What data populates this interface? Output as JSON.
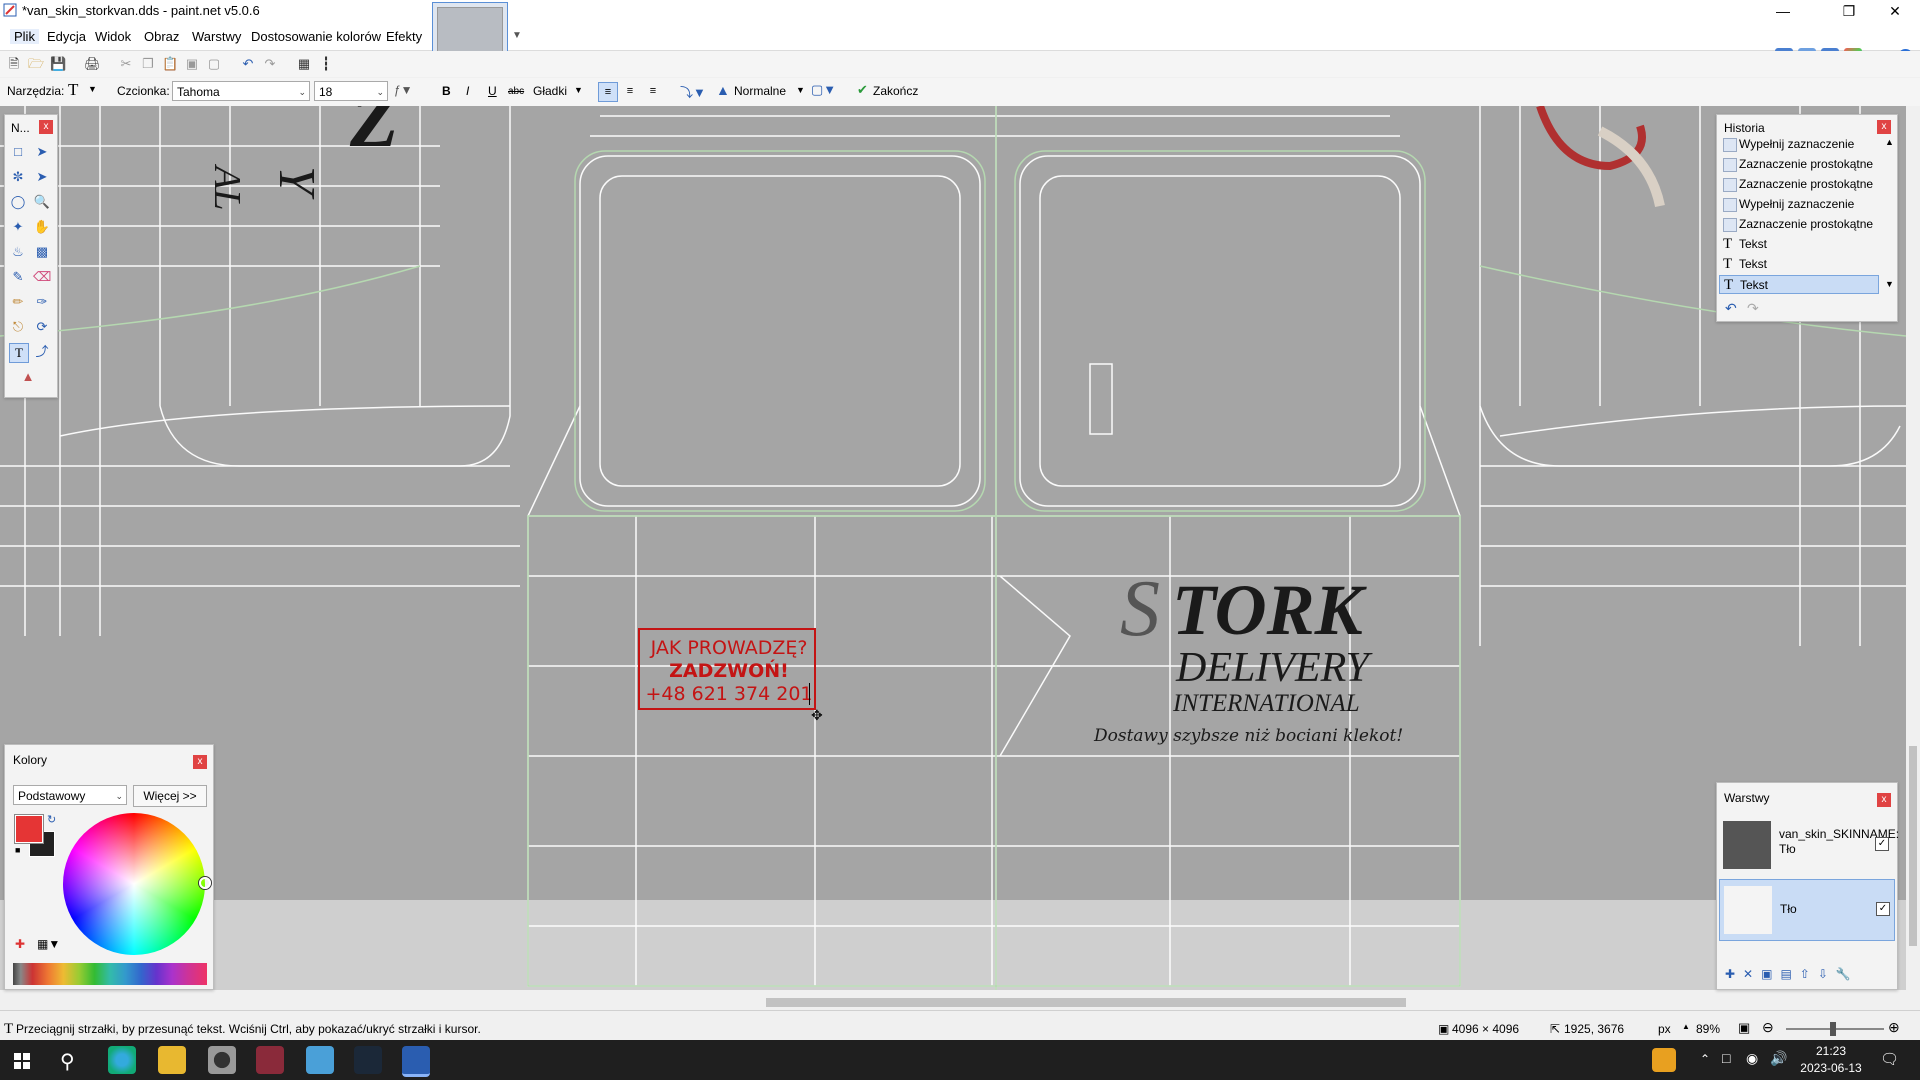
{
  "window": {
    "title": "*van_skin_storkvan.dds - paint.net v5.0.6"
  },
  "menu": [
    "Plik",
    "Edycja",
    "Widok",
    "Obraz",
    "Warstwy",
    "Dostosowanie kolorów",
    "Efekty"
  ],
  "toolbar2": {
    "tool_label": "Narzędzia:",
    "font_label": "Czcionka:",
    "font_value": "Tahoma",
    "size_value": "18",
    "bold": "B",
    "italic": "I",
    "underline": "U",
    "strike": "abc",
    "antialias": "Gładki",
    "blend": "Normalne",
    "finish": "Zakończ"
  },
  "tools_panel": {
    "title": "N..."
  },
  "history": {
    "title": "Historia",
    "items": [
      "Wypełnij zaznaczenie",
      "Zaznaczenie prostokątne",
      "Zaznaczenie prostokątne",
      "Wypełnij zaznaczenie",
      "Zaznaczenie prostokątne",
      "Tekst",
      "Tekst",
      "Tekst"
    ],
    "selected_index": 7
  },
  "colors": {
    "title": "Kolory",
    "mode": "Podstawowy",
    "more": "Więcej >>",
    "primary": "#e53535",
    "secondary": "#222222"
  },
  "layers": {
    "title": "Warstwy",
    "items": [
      {
        "name": "van_skin_SKINNAME: Tło",
        "visible": true
      },
      {
        "name": "Tło",
        "visible": true
      }
    ]
  },
  "canvas_text": {
    "line1": "JAK PROWADZĘ?",
    "line2": "ZADZWOŃ!",
    "line3": "+48 621 374 201",
    "logo1": "TORK",
    "logo_s": "S",
    "logo2": "DELIVERY",
    "logo3": "INTERNATIONAL",
    "slogan": "Dostawy szybsze niż bociani klekot!"
  },
  "status": {
    "hint": "Przeciągnij strzałki, by przesunąć tekst. Wciśnij Ctrl, aby pokazać/ukryć strzałki i kursor.",
    "image_size": "4096 × 4096",
    "cursor_pos": "1925, 3676",
    "unit": "px",
    "zoom": "89%"
  },
  "taskbar": {
    "time": "21:23",
    "date": "2023-06-13"
  }
}
